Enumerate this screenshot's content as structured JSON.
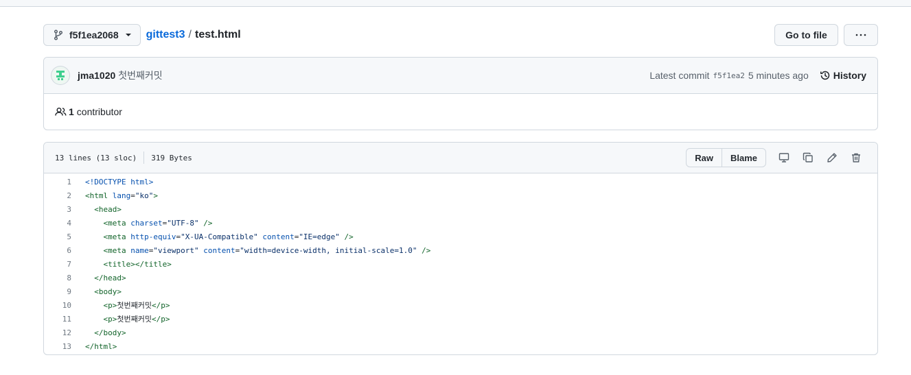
{
  "header": {
    "branch": "f5f1ea2068",
    "repo": "gittest3",
    "separator": "/",
    "file": "test.html",
    "go_to_file": "Go to file",
    "more": "···"
  },
  "commit": {
    "author": "jma1020",
    "message": "첫번째커밋",
    "latest_label": "Latest commit",
    "sha": "f5f1ea2",
    "time": "5 minutes ago",
    "history_label": "History"
  },
  "contributors": {
    "count": "1",
    "label": "contributor"
  },
  "file": {
    "lines_info": "13 lines (13 sloc)",
    "size": "319 Bytes",
    "raw_label": "Raw",
    "blame_label": "Blame"
  },
  "code": {
    "lines": [
      {
        "n": "1",
        "text": "<!DOCTYPE html>"
      },
      {
        "n": "2",
        "text": "<html lang=\"ko\">"
      },
      {
        "n": "3",
        "text": "  <head>"
      },
      {
        "n": "4",
        "text": "    <meta charset=\"UTF-8\" />"
      },
      {
        "n": "5",
        "text": "    <meta http-equiv=\"X-UA-Compatible\" content=\"IE=edge\" />"
      },
      {
        "n": "6",
        "text": "    <meta name=\"viewport\" content=\"width=device-width, initial-scale=1.0\" />"
      },
      {
        "n": "7",
        "text": "    <title></title>"
      },
      {
        "n": "8",
        "text": "  </head>"
      },
      {
        "n": "9",
        "text": "  <body>"
      },
      {
        "n": "10",
        "text": "    <p>첫번째커밋</p>"
      },
      {
        "n": "11",
        "text": "    <p>첫번째커밋</p>"
      },
      {
        "n": "12",
        "text": "  </body>"
      },
      {
        "n": "13",
        "text": "</html>"
      }
    ]
  },
  "colors": {
    "link": "#0969da",
    "tag": "#116329",
    "attr": "#0550ae",
    "string": "#0a3069"
  }
}
